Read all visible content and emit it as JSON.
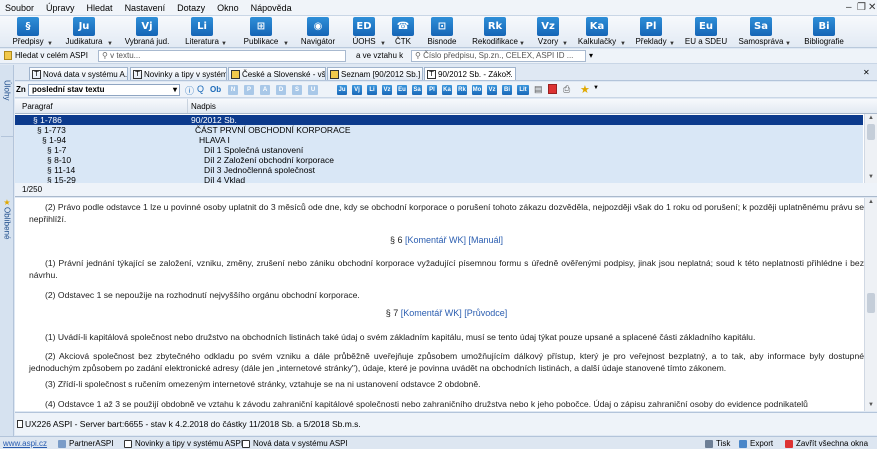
{
  "menu": [
    "Soubor",
    "Úpravy",
    "Hledat",
    "Nastavení",
    "Dotazy",
    "Okno",
    "Nápověda"
  ],
  "toolbar": [
    {
      "glyph": "§",
      "label": "Předpisy"
    },
    {
      "glyph": "Ju",
      "label": "Judikatura"
    },
    {
      "glyph": "Vj",
      "label": "Vybraná jud."
    },
    {
      "glyph": "Li",
      "label": "Literatura"
    },
    {
      "glyph": "⊞",
      "label": "Publikace"
    },
    {
      "glyph": "◉",
      "label": "Navigátor"
    },
    {
      "glyph": "ED",
      "label": "ÚOHS"
    },
    {
      "glyph": "☎",
      "label": "ČTK"
    },
    {
      "glyph": "⊡",
      "label": "Bisnode"
    },
    {
      "glyph": "Rk",
      "label": "Rekodifikace"
    },
    {
      "glyph": "Vz",
      "label": "Vzory"
    },
    {
      "glyph": "Ka",
      "label": "Kalkulačky"
    },
    {
      "glyph": "Pl",
      "label": "Překlady"
    },
    {
      "glyph": "Eu",
      "label": "EU a SDEU"
    },
    {
      "glyph": "Sa",
      "label": "Samospráva"
    },
    {
      "glyph": "Bi",
      "label": "Bibliografie"
    }
  ],
  "search": {
    "all_label": "Hledat v celém ASPI",
    "text_placeholder": "v textu...",
    "relation_label": "a ve vztahu k",
    "number_placeholder": "Číslo předpisu, Sp.zn., CELEX, ASPI ID ..."
  },
  "side_tabs": [
    "Úlohy",
    "Oblíbené"
  ],
  "doc_tabs": [
    {
      "label": "Nová data v systému A...",
      "active": false
    },
    {
      "label": "Novinky a tipy v systém...",
      "active": false
    },
    {
      "label": "České a Slovenské - vše...",
      "active": false
    },
    {
      "label": "Seznam [90/2012 Sb.]",
      "active": false
    },
    {
      "label": "90/2012 Sb. - Záko...",
      "active": true
    }
  ],
  "viewbar": {
    "zn_label": "Zn",
    "version_select": "poslední stav textu",
    "icon_labels": [
      "Q",
      "Ob",
      "N",
      "P",
      "A",
      "D",
      "S",
      "U",
      "Ju",
      "Vj",
      "Li",
      "Vz",
      "Eu",
      "Sa",
      "Pl",
      "Ka",
      "Rk",
      "Mo",
      "Vz",
      "Bi",
      "Lit"
    ]
  },
  "grid": {
    "columns": [
      "Paragraf",
      "Nadpis"
    ],
    "rows": [
      {
        "paragraph": "§ 1-786",
        "title": "90/2012 Sb.",
        "indent": 0,
        "selected": true
      },
      {
        "paragraph": "§ 1-773",
        "title": "ČÁST PRVNÍ OBCHODNÍ KORPORACE",
        "indent": 1,
        "selected": false
      },
      {
        "paragraph": "§ 1-94",
        "title": "HLAVA I",
        "indent": 2,
        "selected": false
      },
      {
        "paragraph": "§ 1-7",
        "title": "Díl 1 Společná ustanovení",
        "indent": 3,
        "selected": false
      },
      {
        "paragraph": "§ 8-10",
        "title": "Díl 2 Založení obchodní korporace",
        "indent": 3,
        "selected": false
      },
      {
        "paragraph": "§ 11-14",
        "title": "Díl 3 Jednočlenná společnost",
        "indent": 3,
        "selected": false
      },
      {
        "paragraph": "§ 15-29",
        "title": "Díl 4 Vklad",
        "indent": 3,
        "selected": false
      }
    ],
    "footer": "1/250"
  },
  "document": {
    "p1": "(2) Právo podle odstavce 1 lze u povinné osoby uplatnit do 3 měsíců ode dne, kdy se obchodní korporace o porušení tohoto zákazu dozvěděla, nejpozději však do 1 roku od porušení; k později uplatněnému právu se nepřihlíží.",
    "s6": "§ 6",
    "s6_link1": "[Komentář WK]",
    "s6_link2": "[Manuál]",
    "p2": "(1) Právní jednání týkající se založení, vzniku, změny, zrušení nebo zániku obchodní korporace vyžadující písemnou formu s úředně ověřenými podpisy, jinak jsou neplatná; soud k této neplatnosti přihlédne i bez návrhu.",
    "p3": "(2) Odstavec 1 se nepoužije na rozhodnutí nejvyššího orgánu obchodní korporace.",
    "s7": "§ 7",
    "s7_link1": "[Komentář WK]",
    "s7_link2": "[Průvodce]",
    "p4": "(1) Uvádí-li kapitálová společnost nebo družstvo na obchodních listinách také údaj o svém základním kapitálu, musí se tento údaj týkat pouze upsané a splacené části základního kapitálu.",
    "p5": "(2) Akciová společnost bez zbytečného odkladu po svém vzniku a dále průběžně uveřejňuje způsobem umožňujícím dálkový přístup, který je pro veřejnost bezplatný, a to tak, aby informace byly dostupné jednoduchým způsobem po zadání elektronické adresy (dále jen „internetové stránky\"), údaje, které je povinna uvádět na obchodních listinách, a další údaje stanovené tímto zákonem.",
    "p6": "(3) Zřídí-li společnost s ručením omezeným internetové stránky, vztahuje se na ni ustanovení odstavce 2 obdobně.",
    "p7": "(4) Odstavce 1 až 3 se použijí obdobně ve vztahu k závodu zahraniční kapitálové společnosti nebo zahraničního družstva nebo k jeho pobočce. Údaj o zápisu zahraniční osoby do evidence podnikatelů"
  },
  "status": "UX226 ASPI - Server bart:6655 - stav k 4.2.2018 do částky 11/2018 Sb. a 5/2018 Sb.m.s.",
  "taskbar": {
    "link": "www.aspi.cz",
    "items": [
      "PartnerASPI",
      "Novinky a tipy v systému ASPI",
      "Nová data v systému ASPI"
    ],
    "actions": [
      "Tisk",
      "Export",
      "Zavřít všechna okna"
    ]
  },
  "colors": {
    "accent": "#1b6ab9",
    "selection": "#0c3a8c",
    "row_highlight": "#d9e7f6",
    "link": "#2a5db0"
  }
}
